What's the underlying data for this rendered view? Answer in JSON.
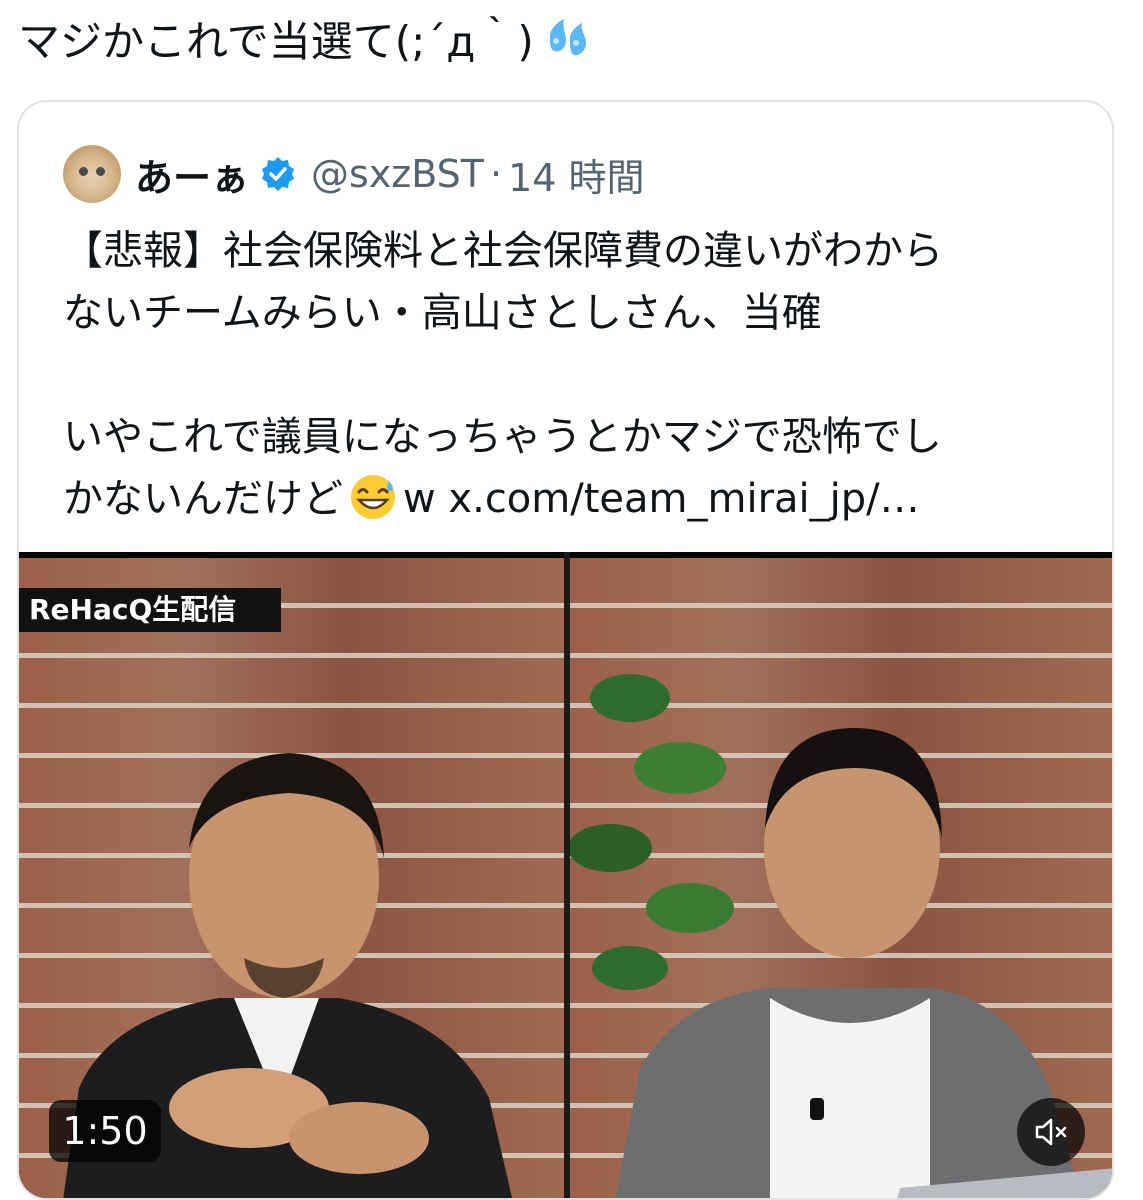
{
  "tweet": {
    "text": "マジかこれで当選て(;´д｀)",
    "emoji": "sweat-droplets"
  },
  "quote": {
    "display_name": "あーぁ",
    "handle": "@sxzBST",
    "separator": "·",
    "time": "14 時間",
    "body_line1": "【悲報】社会保険料と社会保障費の違いがわから",
    "body_line2": "ないチームみらい・高山さとしさん、当確",
    "body_line3": "いやこれで議員になっちゃうとかマジで恐怖でし",
    "body_line4_pre": "かないんだけど",
    "body_line4_post": "w x.com/team_mirai_jp/…",
    "emoji": "grinning-sweat"
  },
  "media": {
    "logo_text": "ReHacQ生配信",
    "duration": "1:50",
    "mute_icon": "speaker-muted-icon"
  },
  "colors": {
    "text_primary": "#0f1419",
    "text_secondary": "#536471",
    "border": "#dfe3e6",
    "verified": "#1d9bf0"
  }
}
